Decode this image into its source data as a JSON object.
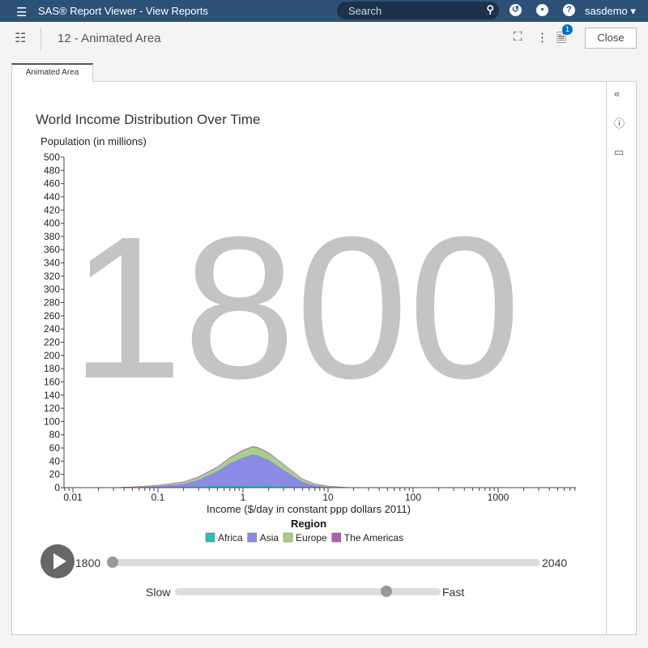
{
  "header": {
    "app_title": "SAS® Report Viewer - View Reports",
    "search_placeholder": "Search",
    "user": "sasdemo ▾"
  },
  "toolbar": {
    "report_title": "12 - Animated Area",
    "badge_count": "1",
    "close_label": "Close"
  },
  "tabs": [
    {
      "label": "Animated Area"
    }
  ],
  "chart_data": {
    "type": "area",
    "stacked": true,
    "title": "World Income Distribution Over Time",
    "ylabel": "Population (in millions)",
    "xlabel": "Income ($/day in constant ppp dollars 2011)",
    "xscale": "log",
    "xlim": [
      0.008,
      8000
    ],
    "ylim": [
      0,
      500
    ],
    "yticks": [
      0,
      20,
      40,
      60,
      80,
      100,
      120,
      140,
      160,
      180,
      200,
      220,
      240,
      260,
      280,
      300,
      320,
      340,
      360,
      380,
      400,
      420,
      440,
      460,
      480,
      500
    ],
    "xtick_labels": [
      "0.01",
      "0.1",
      "1",
      "10",
      "100",
      "1000"
    ],
    "year_watermark": "1800",
    "legend_title": "Region",
    "x": [
      0.03,
      0.05,
      0.1,
      0.2,
      0.3,
      0.5,
      0.7,
      1,
      1.3,
      1.5,
      2,
      3,
      5,
      7,
      10,
      15,
      20
    ],
    "series": [
      {
        "name": "Africa",
        "color": "#2bbcbc",
        "values": [
          0,
          0.2,
          0.5,
          1,
          2,
          3,
          4,
          4,
          3.5,
          3,
          2.5,
          2,
          1,
          0.5,
          0.2,
          0,
          0
        ]
      },
      {
        "name": "Asia",
        "color": "#8b8be6",
        "values": [
          0,
          0.5,
          2,
          5,
          10,
          22,
          33,
          42,
          47,
          46,
          40,
          25,
          8,
          3,
          1,
          0.3,
          0
        ]
      },
      {
        "name": "Europe",
        "color": "#a6d08a",
        "values": [
          0,
          0.3,
          1,
          2.5,
          4,
          6,
          8,
          10,
          11,
          11,
          10,
          8,
          4,
          2,
          1,
          0.3,
          0
        ]
      },
      {
        "name": "The Americas",
        "color": "#b060a8",
        "values": [
          0,
          0,
          0.2,
          0.3,
          0.5,
          0.5,
          0.6,
          0.8,
          0.8,
          0.8,
          0.7,
          0.5,
          0.3,
          0.2,
          0.1,
          0,
          0
        ]
      }
    ]
  },
  "controls": {
    "year_start": "1800",
    "year_end": "2040",
    "year_value": 0,
    "speed_slow": "Slow",
    "speed_fast": "Fast",
    "speed_value": 0.81
  }
}
